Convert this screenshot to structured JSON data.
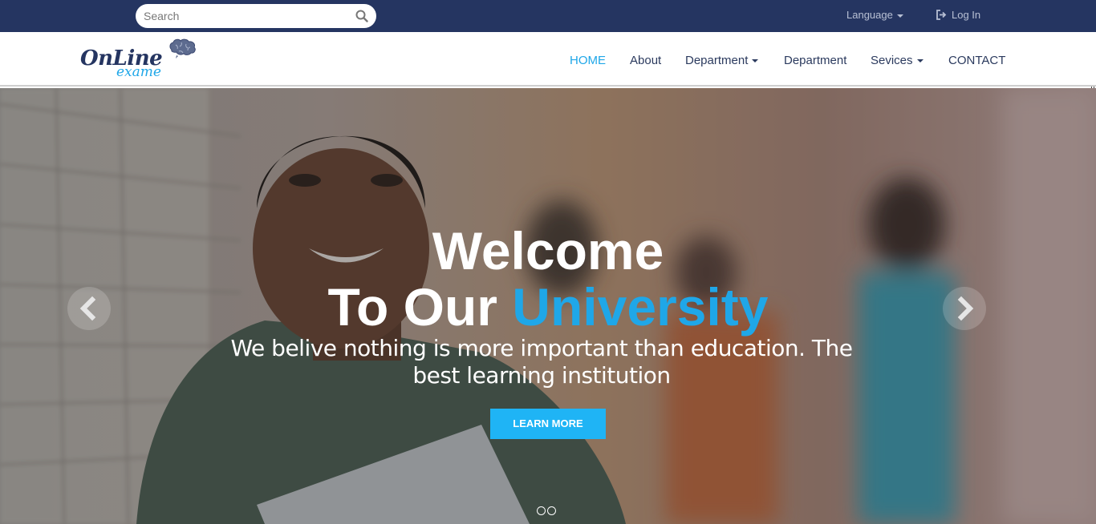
{
  "topbar": {
    "search": {
      "placeholder": "Search",
      "value": ""
    },
    "language_label": "Language",
    "login_label": "Log In"
  },
  "logo": {
    "line1": "OnLine",
    "line2": "exame"
  },
  "nav": {
    "items": [
      {
        "label": "HOME",
        "active": true
      },
      {
        "label": "About"
      },
      {
        "label": "Department",
        "dropdown": true
      },
      {
        "label": "Department"
      },
      {
        "label": "Sevices",
        "dropdown": true
      },
      {
        "label": "CONTACT"
      }
    ]
  },
  "hero": {
    "title_line1": "Welcome",
    "title_line2_prefix": "To Our",
    "title_line2_accent": "University",
    "subtitle": "We belive nothing is more important than education. The best learning institution",
    "button_label": "LEARN MORE",
    "slide_count": 2
  },
  "colors": {
    "topbar": "#253561",
    "accent": "#1fa7e8",
    "button": "#1fb4f5"
  }
}
